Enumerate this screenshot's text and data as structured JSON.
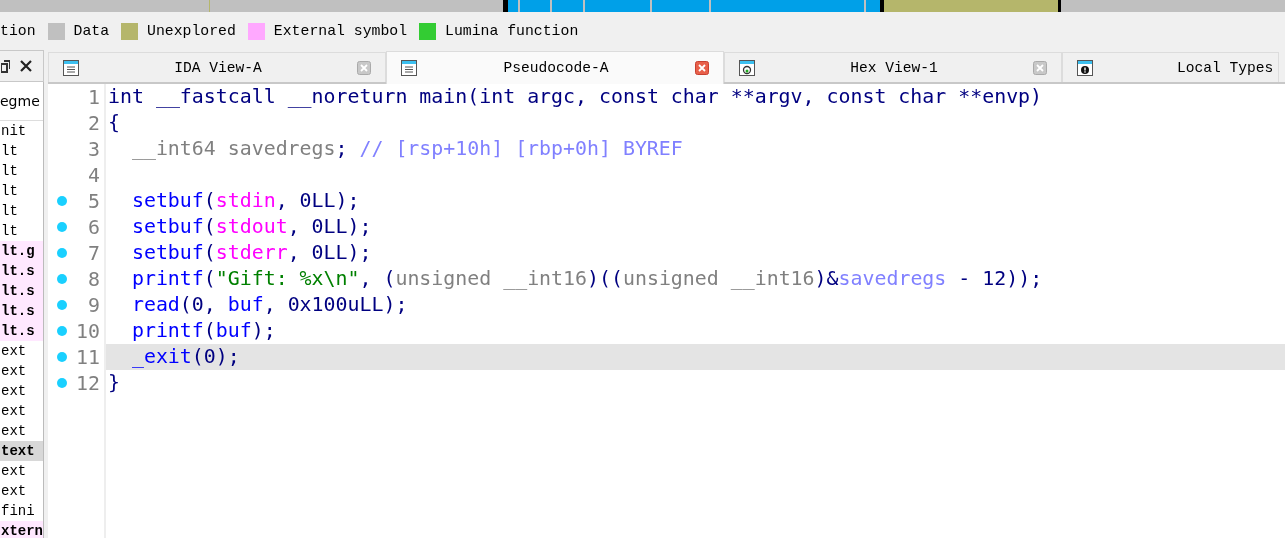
{
  "legend": [
    {
      "label": "tion"
    },
    {
      "label": "Data",
      "color": "#c0c0c0"
    },
    {
      "label": "Unexplored",
      "color": "#b5b66b"
    },
    {
      "label": "External symbol",
      "color": "#ffa8ff"
    },
    {
      "label": "Lumina function",
      "color": "#33cc33"
    }
  ],
  "segments_panel": {
    "header": "egme",
    "items": [
      {
        "label": "nit",
        "kind": "normal",
        "selected": false
      },
      {
        "label": "lt",
        "kind": "normal",
        "selected": false
      },
      {
        "label": "lt",
        "kind": "normal",
        "selected": false
      },
      {
        "label": "lt",
        "kind": "normal",
        "selected": false
      },
      {
        "label": "lt",
        "kind": "normal",
        "selected": false
      },
      {
        "label": "lt",
        "kind": "normal",
        "selected": false
      },
      {
        "label": "lt.g",
        "kind": "extern",
        "selected": false
      },
      {
        "label": "lt.s",
        "kind": "extern",
        "selected": false
      },
      {
        "label": "lt.s",
        "kind": "extern",
        "selected": false
      },
      {
        "label": "lt.s",
        "kind": "extern",
        "selected": false
      },
      {
        "label": "lt.s",
        "kind": "extern",
        "selected": false
      },
      {
        "label": "ext",
        "kind": "normal",
        "selected": false
      },
      {
        "label": "ext",
        "kind": "normal",
        "selected": false
      },
      {
        "label": "ext",
        "kind": "normal",
        "selected": false
      },
      {
        "label": "ext",
        "kind": "normal",
        "selected": false
      },
      {
        "label": "ext",
        "kind": "normal",
        "selected": false
      },
      {
        "label": "text",
        "kind": "normal",
        "selected": true
      },
      {
        "label": "ext",
        "kind": "normal",
        "selected": false
      },
      {
        "label": "ext",
        "kind": "normal",
        "selected": false
      },
      {
        "label": "fini",
        "kind": "normal",
        "selected": false
      },
      {
        "label": "xtern",
        "kind": "extern",
        "selected": false
      }
    ]
  },
  "tabs": [
    {
      "label": "IDA View-A",
      "kind": "listing",
      "selected": false
    },
    {
      "label": "Pseudocode-A",
      "kind": "listing",
      "selected": true
    },
    {
      "label": "Hex View-1",
      "kind": "hex",
      "selected": false
    },
    {
      "label": "Local Types",
      "kind": "types",
      "selected": false
    }
  ],
  "code_lines": [
    {
      "number": "1",
      "breakpoint": false,
      "selected": false,
      "indented": false,
      "tokens": [
        {
          "text": "int __fastcall __noreturn main(int argc, const char **argv, const char **envp)",
          "kind": "plain"
        }
      ]
    },
    {
      "number": "2",
      "breakpoint": false,
      "selected": false,
      "indented": false,
      "tokens": [
        {
          "text": "{",
          "kind": "plain"
        }
      ]
    },
    {
      "number": "3",
      "breakpoint": false,
      "selected": false,
      "indented": true,
      "tokens": [
        {
          "text": "__int64 savedregs",
          "kind": "type"
        },
        {
          "text": "; ",
          "kind": "plain"
        },
        {
          "text": "// [rsp+10h] [rbp+0h] BYREF",
          "kind": "comment"
        }
      ]
    },
    {
      "number": "4",
      "breakpoint": false,
      "selected": false
    },
    {
      "number": "5",
      "breakpoint": true,
      "selected": false,
      "indented": true,
      "tokens": [
        {
          "text": "setbuf",
          "kind": "func"
        },
        {
          "text": "(",
          "kind": "plain"
        },
        {
          "text": "stdin",
          "kind": "global"
        },
        {
          "text": ", 0LL);",
          "kind": "plain"
        }
      ]
    },
    {
      "number": "6",
      "breakpoint": true,
      "selected": false,
      "indented": true,
      "tokens": [
        {
          "text": "setbuf",
          "kind": "func"
        },
        {
          "text": "(",
          "kind": "plain"
        },
        {
          "text": "stdout",
          "kind": "global"
        },
        {
          "text": ", 0LL);",
          "kind": "plain"
        }
      ]
    },
    {
      "number": "7",
      "breakpoint": true,
      "selected": false,
      "indented": true,
      "tokens": [
        {
          "text": "setbuf",
          "kind": "func"
        },
        {
          "text": "(",
          "kind": "plain"
        },
        {
          "text": "stderr",
          "kind": "global"
        },
        {
          "text": ", 0LL);",
          "kind": "plain"
        }
      ]
    },
    {
      "number": "8",
      "breakpoint": true,
      "selected": false,
      "indented": true,
      "tokens": [
        {
          "text": "printf",
          "kind": "func"
        },
        {
          "text": "(",
          "kind": "plain"
        },
        {
          "text": "\"Gift: %x\\n\"",
          "kind": "string"
        },
        {
          "text": ", (",
          "kind": "plain"
        },
        {
          "text": "unsigned __int16",
          "kind": "type"
        },
        {
          "text": ")((",
          "kind": "plain"
        },
        {
          "text": "unsigned __int16",
          "kind": "type"
        },
        {
          "text": ")&",
          "kind": "plain"
        },
        {
          "text": "savedregs",
          "kind": "variable"
        },
        {
          "text": " - 12));",
          "kind": "plain"
        }
      ]
    },
    {
      "number": "9",
      "breakpoint": true,
      "selected": false,
      "indented": true,
      "tokens": [
        {
          "text": "read",
          "kind": "func"
        },
        {
          "text": "(0, ",
          "kind": "plain"
        },
        {
          "text": "buf",
          "kind": "func"
        },
        {
          "text": ", 0x100uLL);",
          "kind": "plain"
        }
      ]
    },
    {
      "number": "10",
      "breakpoint": true,
      "selected": false,
      "indented": true,
      "tokens": [
        {
          "text": "printf",
          "kind": "func"
        },
        {
          "text": "(",
          "kind": "plain"
        },
        {
          "text": "buf",
          "kind": "func"
        },
        {
          "text": ");",
          "kind": "plain"
        }
      ]
    },
    {
      "number": "11",
      "breakpoint": true,
      "selected": true,
      "indented": true,
      "tokens": [
        {
          "text": "_exit",
          "kind": "func"
        },
        {
          "text": "(0);",
          "kind": "plain"
        }
      ]
    },
    {
      "number": "12",
      "breakpoint": true,
      "selected": false,
      "indented": false,
      "tokens": [
        {
          "text": "}",
          "kind": "plain"
        }
      ]
    }
  ]
}
